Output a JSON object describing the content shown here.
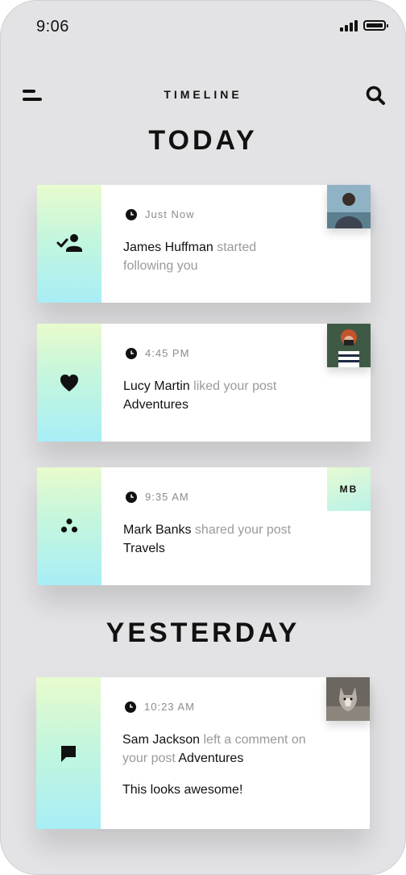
{
  "status_bar": {
    "time": "9:06"
  },
  "header": {
    "title": "TIMELINE"
  },
  "sections": {
    "today": "TODAY",
    "yesterday": "YESTERDAY"
  },
  "notifications": [
    {
      "time": "Just Now",
      "user": "James Huffman",
      "action": " started following you",
      "object": "",
      "icon": "user-check-icon",
      "thumb": "photo"
    },
    {
      "time": "4:45 PM",
      "user": "Lucy Martin",
      "action": " liked your post ",
      "object": "Adventures",
      "icon": "heart-icon",
      "thumb": "photo"
    },
    {
      "time": "9:35 AM",
      "user": "Mark Banks",
      "action": " shared your post ",
      "object": "Travels",
      "icon": "share-icon",
      "badge": "MB"
    },
    {
      "time": "10:23 AM",
      "user": "Sam Jackson",
      "action": " left a comment on your post ",
      "object": "Adventures",
      "comment": "This looks awesome!",
      "icon": "comment-icon",
      "thumb": "photo"
    }
  ],
  "colors": {
    "background": "#e3e3e5",
    "accent_gradient_top": "#e8fbcd",
    "accent_gradient_bottom": "#a8eef6",
    "text_dark": "#111111",
    "text_muted": "#9a9a9a"
  }
}
